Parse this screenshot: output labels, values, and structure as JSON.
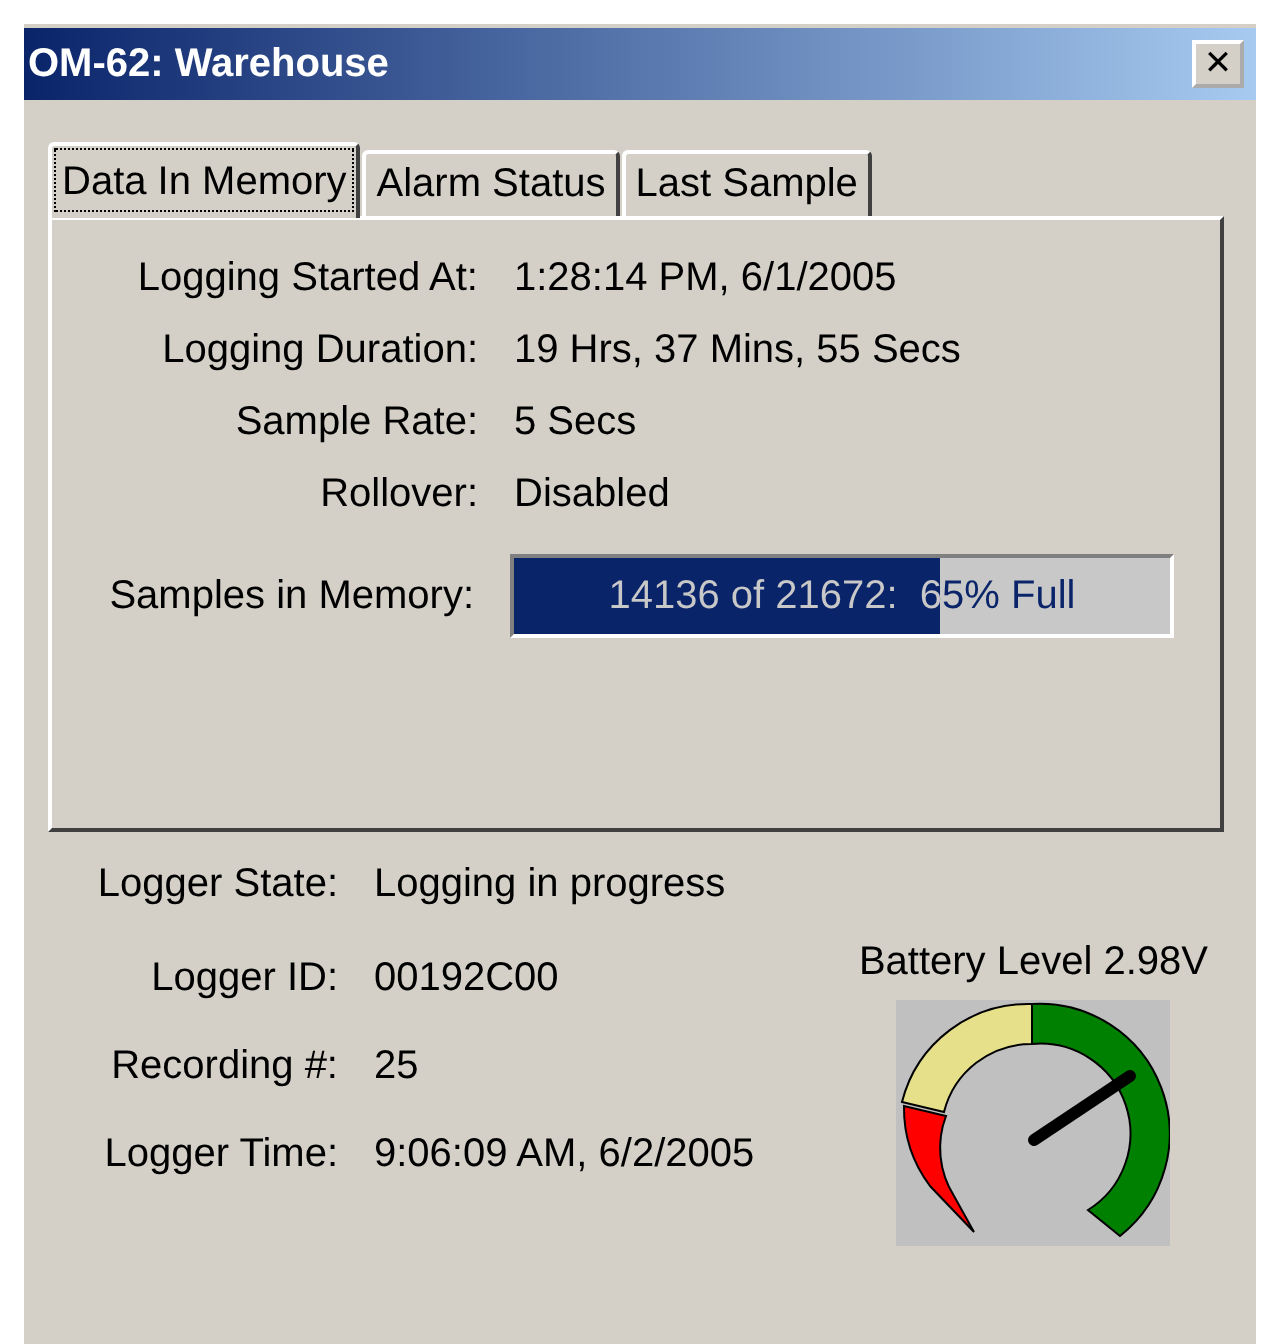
{
  "window": {
    "title": "OM-62: Warehouse",
    "close": "✕"
  },
  "tabs": [
    {
      "label": "Data In Memory",
      "selected": true
    },
    {
      "label": "Alarm Status",
      "selected": false
    },
    {
      "label": "Last Sample",
      "selected": false
    }
  ],
  "memory_fields": [
    {
      "label": "Logging Started At:",
      "value": "1:28:14 PM, 6/1/2005"
    },
    {
      "label": "Logging Duration:",
      "value": "19 Hrs, 37 Mins, 55 Secs"
    },
    {
      "label": "Sample Rate:",
      "value": "5 Secs"
    },
    {
      "label": "Rollover:",
      "value": "Disabled"
    }
  ],
  "samples": {
    "label": "Samples in Memory:",
    "reading": "14136 of 21672:  65% Full",
    "level": 0.65
  },
  "logger_fields": [
    {
      "label": "Logger State:",
      "value": "Logging in progress"
    },
    {
      "label": "Logger ID:",
      "value": "00192C00"
    },
    {
      "label": "Recording #:",
      "value": "25"
    },
    {
      "label": "Logger Time:",
      "value": "9:06:09 AM, 6/2/2005"
    }
  ],
  "battery": {
    "label": "Battery Level 2.98V"
  }
}
